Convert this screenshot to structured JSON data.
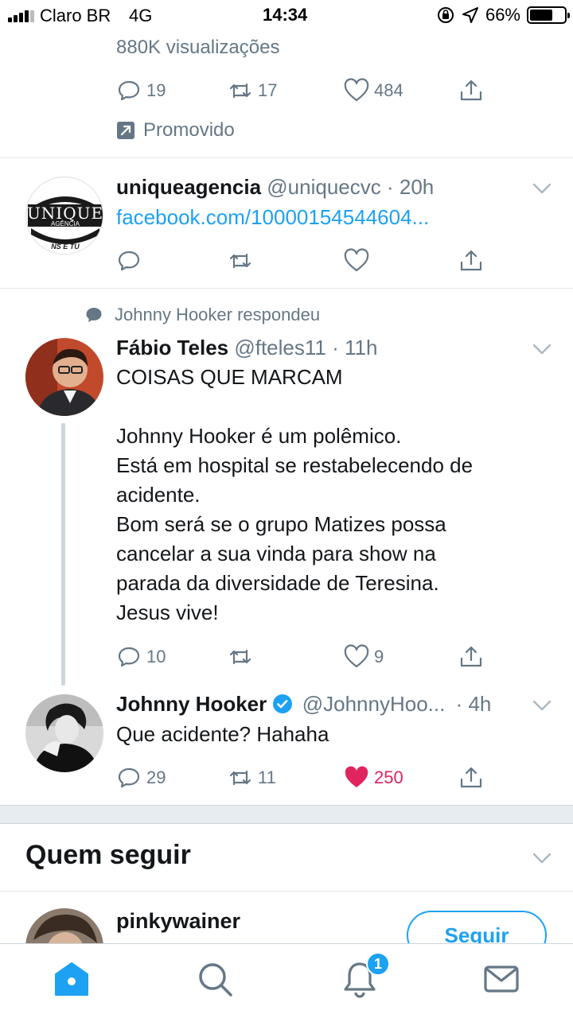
{
  "status_bar": {
    "carrier": "Claro BR",
    "network": "4G",
    "time": "14:34",
    "battery": "66%",
    "battery_level": 0.66
  },
  "promoted_tweet": {
    "views": "880K visualizações",
    "replies": "19",
    "retweets": "17",
    "likes": "484",
    "promoted_label": "Promovido"
  },
  "tweet_unique": {
    "avatar_text": "UNIQUE",
    "avatar_sub": "AGÊNCIA",
    "avatar_bottom": "NS E TU",
    "name": "uniqueagencia",
    "handle": "@uniquecvc",
    "time": "· 20h",
    "link": "facebook.com/10000154544604..."
  },
  "tweet_fabio": {
    "context": "Johnny Hooker respondeu",
    "name": "Fábio Teles",
    "handle": "@fteles11",
    "time": "· 11h",
    "lines": [
      "COISAS QUE MARCAM",
      "",
      "Johnny Hooker é um polêmico.",
      "Está em hospital se restabelecendo de",
      "acidente.",
      "Bom será se o grupo Matizes possa",
      "cancelar a sua vinda para show na",
      "parada da diversidade de Teresina.",
      "Jesus vive!"
    ],
    "replies": "10",
    "likes": "9"
  },
  "tweet_johnny": {
    "name": "Johnny Hooker",
    "handle": "@JohnnyHoo...",
    "time": "· 4h",
    "text": "Que acidente? Hahaha",
    "replies": "29",
    "retweets": "11",
    "likes": "250"
  },
  "who_to_follow": {
    "title": "Quem seguir",
    "user_name": "pinkywainer",
    "follow_label": "Seguir"
  },
  "tabbar": {
    "notification_count": "1"
  },
  "colors": {
    "accent": "#1da1f2",
    "muted": "#657786",
    "like": "#e0245e",
    "text": "#14171a"
  }
}
